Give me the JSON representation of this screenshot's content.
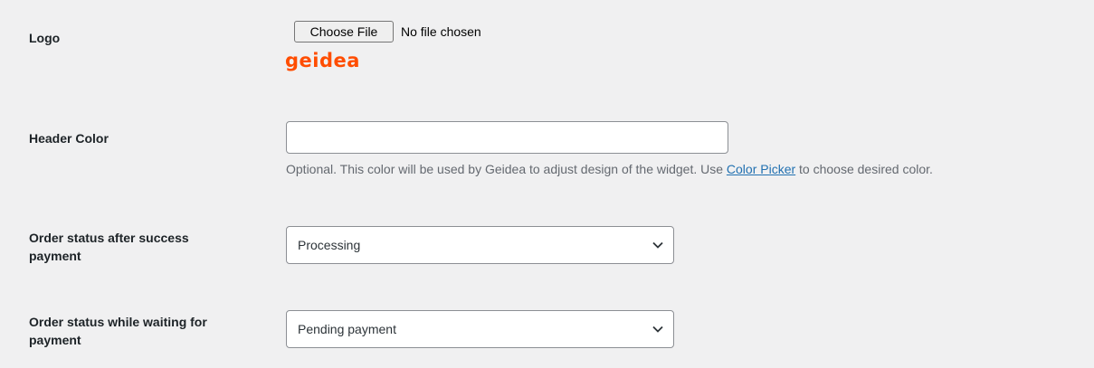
{
  "logo_row": {
    "label": "Logo",
    "choose_file_label": "Choose File",
    "file_status": "No file chosen",
    "logo_text": "geidea"
  },
  "header_color_row": {
    "label": "Header Color",
    "value": "",
    "description_before": "Optional. This color will be used by Geidea to adjust design of the widget. Use ",
    "link_text": "Color Picker",
    "description_after": " to choose desired color."
  },
  "order_success_row": {
    "label_line1": "Order status after success",
    "label_line2": "payment",
    "selected": "Processing"
  },
  "order_waiting_row": {
    "label_line1": "Order status while waiting for",
    "label_line2": "payment",
    "selected": "Pending payment"
  },
  "colors": {
    "background": "#f0f0f1",
    "brand_orange": "#ff4d00",
    "link": "#2271b1"
  },
  "icons": {
    "select_arrow": "chevron-down-icon"
  }
}
